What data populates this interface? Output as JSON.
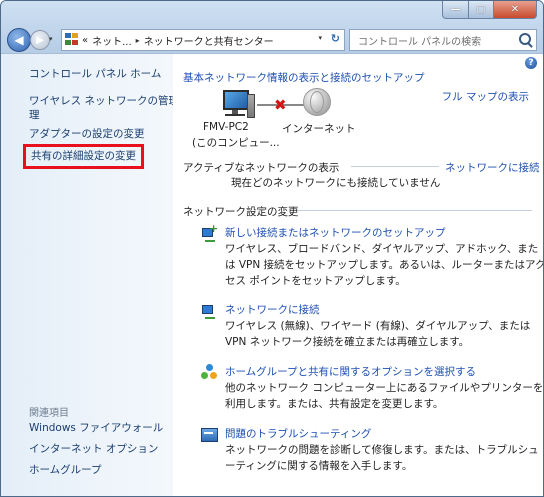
{
  "window": {
    "caption_buttons": {
      "minimize_glyph": "—",
      "maximize_glyph": "□",
      "close_glyph": "✕"
    }
  },
  "nav": {
    "back_glyph": "◀",
    "forward_glyph": "▶",
    "history_glyph": "▾",
    "address_prefix": "«",
    "address_crumbs": [
      "ネット...",
      "ネットワークと共有センター"
    ],
    "address_sep": "▸",
    "dropdown_glyph": "▾",
    "refresh_glyph": "↻",
    "search_placeholder": "コントロール パネルの検索"
  },
  "sidebar": {
    "home": "コントロール パネル ホーム",
    "items": [
      "ワイヤレス ネットワークの管理",
      "理",
      "アダプターの設定の変更",
      "共有の詳細設定の変更"
    ],
    "see_also_heading": "関連項目",
    "see_also": [
      "Windows ファイアウォール",
      "インターネット オプション",
      "ホームグループ"
    ]
  },
  "main": {
    "help_glyph": "?",
    "title": "基本ネットワーク情報の表示と接続のセットアップ",
    "full_map": "フル マップの表示",
    "computer_name": "FMV-PC2",
    "computer_sub": "(このコンピュー...",
    "x_glyph": "✖",
    "internet": "インターネット",
    "active_label": "アクティブなネットワークの表示",
    "active_link": "ネットワークに接続",
    "active_status": "現在どのネットワークにも接続していません",
    "settings_label": "ネットワーク設定の変更",
    "tasks": [
      {
        "title": "新しい接続またはネットワークのセットアップ",
        "desc": "ワイヤレス、ブロードバンド、ダイヤルアップ、アドホック、または VPN 接続をセットアップします。あるいは、ルーターまたはアクセス ポイントをセットアップします。"
      },
      {
        "title": "ネットワークに接続",
        "desc": "ワイヤレス (無線)、ワイヤード (有線)、ダイヤルアップ、または VPN ネットワーク接続を確立または再確立します。"
      },
      {
        "title": "ホームグループと共有に関するオプションを選択する",
        "desc": "他のネットワーク コンピューター上にあるファイルやプリンターを利用します。または、共有設定を変更します。"
      },
      {
        "title": "問題のトラブルシューティング",
        "desc": "ネットワークの問題を診断して修復します。または、トラブルシューティングに関する情報を入手します。"
      }
    ]
  },
  "colors": {
    "link": "#1d4fb2",
    "highlight_border": "#e8101c"
  }
}
